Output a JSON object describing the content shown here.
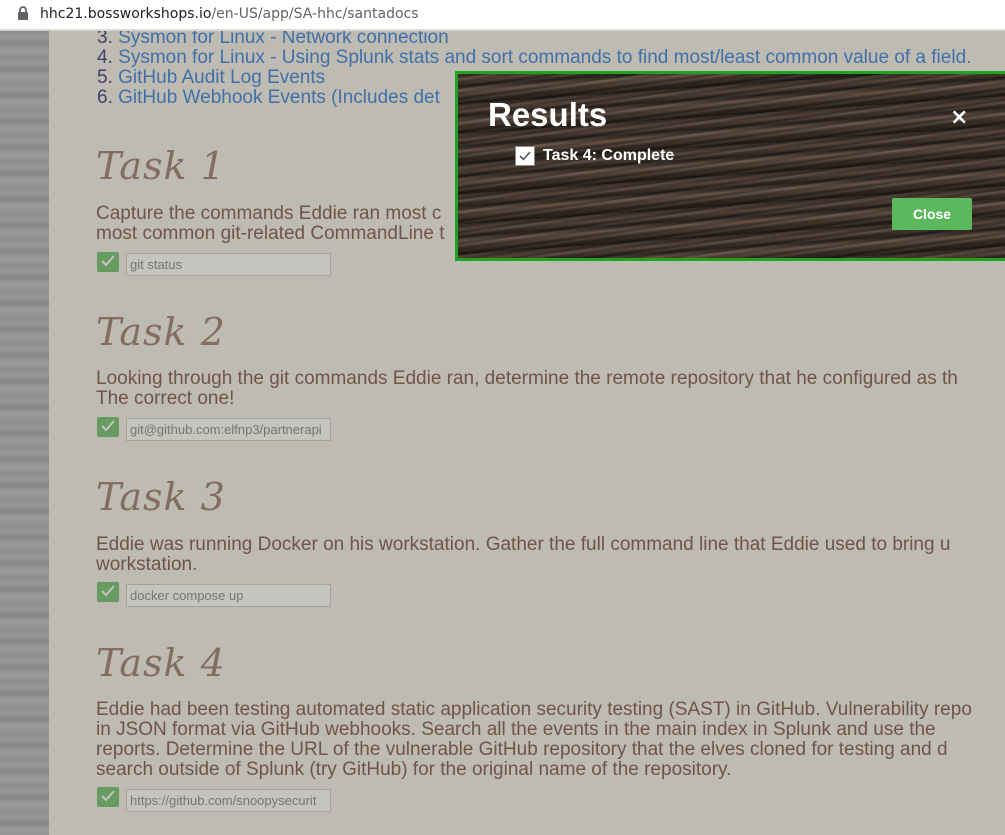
{
  "browser": {
    "url_host": "hhc21.bossworkshops.io",
    "url_path": "/en-US/app/SA-hhc/santadocs"
  },
  "list": [
    {
      "num": "3.",
      "text": "Sysmon for Linux - Network connection"
    },
    {
      "num": "4.",
      "text": "Sysmon for Linux - Using Splunk stats and sort commands to find most/least common value of a field."
    },
    {
      "num": "5.",
      "text": "GitHub Audit Log Events"
    },
    {
      "num": "6.",
      "text": "GitHub Webhook Events (Includes det"
    }
  ],
  "tasks": [
    {
      "heading": "Task 1",
      "lines": [
        "Capture the commands Eddie ran most c",
        "most common git-related CommandLine t"
      ],
      "answer": "git status"
    },
    {
      "heading": "Task 2",
      "lines": [
        "Looking through the git commands Eddie ran, determine the remote repository that he configured as th",
        "The correct one!"
      ],
      "answer": "git@github.com:elfnp3/partnerapi"
    },
    {
      "heading": "Task 3",
      "lines": [
        "Eddie was running Docker on his workstation. Gather the full command line that Eddie used to bring u",
        "workstation."
      ],
      "answer": "docker compose up"
    },
    {
      "heading": "Task 4",
      "lines": [
        "Eddie had been testing automated static application security testing (SAST) in GitHub. Vulnerability repo",
        "in JSON format via GitHub webhooks. Search all the events in the main index in Splunk and use the",
        "reports. Determine the URL of the vulnerable GitHub repository that the elves cloned for testing and d",
        "search outside of Splunk (try GitHub) for the original name of the repository."
      ],
      "answer": "https://github.com/snoopysecurit"
    }
  ],
  "modal": {
    "title": "Results",
    "close_x": "×",
    "result_label": "Task 4: Complete",
    "close_button": "Close",
    "border_color": "#1ea31e",
    "button_color": "#5cb85c"
  }
}
